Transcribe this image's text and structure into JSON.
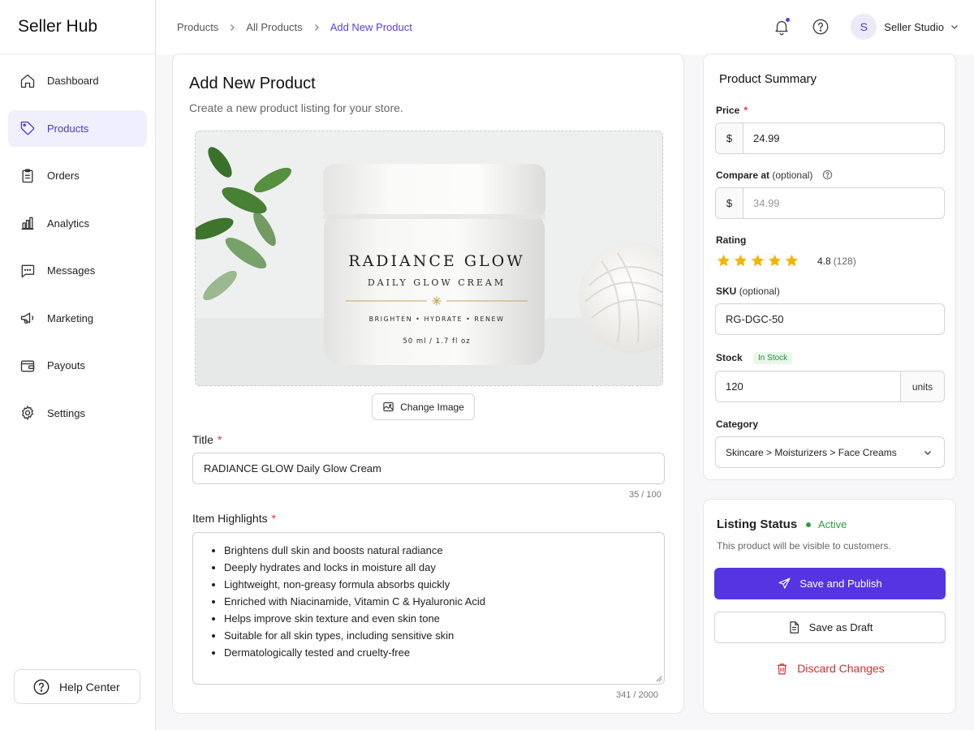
{
  "brand": "Seller Hub",
  "sidebar": {
    "items": [
      {
        "label": "Dashboard",
        "icon": "home-icon"
      },
      {
        "label": "Products",
        "icon": "tag-icon",
        "active": true
      },
      {
        "label": "Orders",
        "icon": "clipboard-icon"
      },
      {
        "label": "Analytics",
        "icon": "bar-chart-icon"
      },
      {
        "label": "Messages",
        "icon": "chat-icon"
      },
      {
        "label": "Marketing",
        "icon": "megaphone-icon"
      },
      {
        "label": "Payouts",
        "icon": "wallet-icon"
      },
      {
        "label": "Settings",
        "icon": "gear-icon"
      }
    ],
    "help_label": "Help Center"
  },
  "breadcrumb": [
    "Products",
    "All Products",
    "Add New Product"
  ],
  "user": {
    "initial": "S",
    "name": "Seller Studio"
  },
  "form": {
    "heading": "Add New Product",
    "subheading": "Create a new product listing for your store.",
    "product_image": {
      "brand_line": "RADIANCE GLOW",
      "product_line": "DAILY GLOW CREAM",
      "benefits_line": "BRIGHTEN • HYDRATE • RENEW",
      "size_line": "50 ml / 1.7 fl oz"
    },
    "change_image_label": "Change Image",
    "title_label": "Title",
    "title_value": "RADIANCE GLOW Daily Glow Cream",
    "title_counter": "35 / 100",
    "highlights_label": "Item Highlights",
    "highlights": [
      "Brightens dull skin and boosts natural radiance",
      "Deeply hydrates and locks in moisture all day",
      "Lightweight, non-greasy formula absorbs quickly",
      "Enriched with Niacinamide, Vitamin C & Hyaluronic Acid",
      "Helps improve skin texture and even skin tone",
      "Suitable for all skin types, including sensitive skin",
      "Dermatologically tested and cruelty-free"
    ],
    "highlights_counter": "341 / 2000",
    "required_marker": "*"
  },
  "summary": {
    "title": "Product Summary",
    "price_label": "Price",
    "currency": "$",
    "price_value": "24.99",
    "compare_label": "Compare at",
    "compare_optional": "(optional)",
    "compare_value": "34.99",
    "rating_label": "Rating",
    "rating_stars": 5,
    "rating_value": "4.8",
    "rating_count": "(128)",
    "sku_label": "SKU",
    "sku_optional": "(optional)",
    "sku_value": "RG-DGC-50",
    "stock_label": "Stock",
    "stock_badge": "In Stock",
    "stock_value": "120",
    "stock_unit": "units",
    "category_label": "Category",
    "category_value": "Skincare > Moisturizers > Face Creams"
  },
  "listing": {
    "title": "Listing Status",
    "status": "Active",
    "note": "This product will be visible to customers.",
    "publish_label": "Save and Publish",
    "draft_label": "Save as Draft",
    "discard_label": "Discard Changes"
  },
  "colors": {
    "accent": "#5534e1",
    "active_green": "#2e9b43",
    "danger": "#d32f2f",
    "star": "#f4b400"
  }
}
